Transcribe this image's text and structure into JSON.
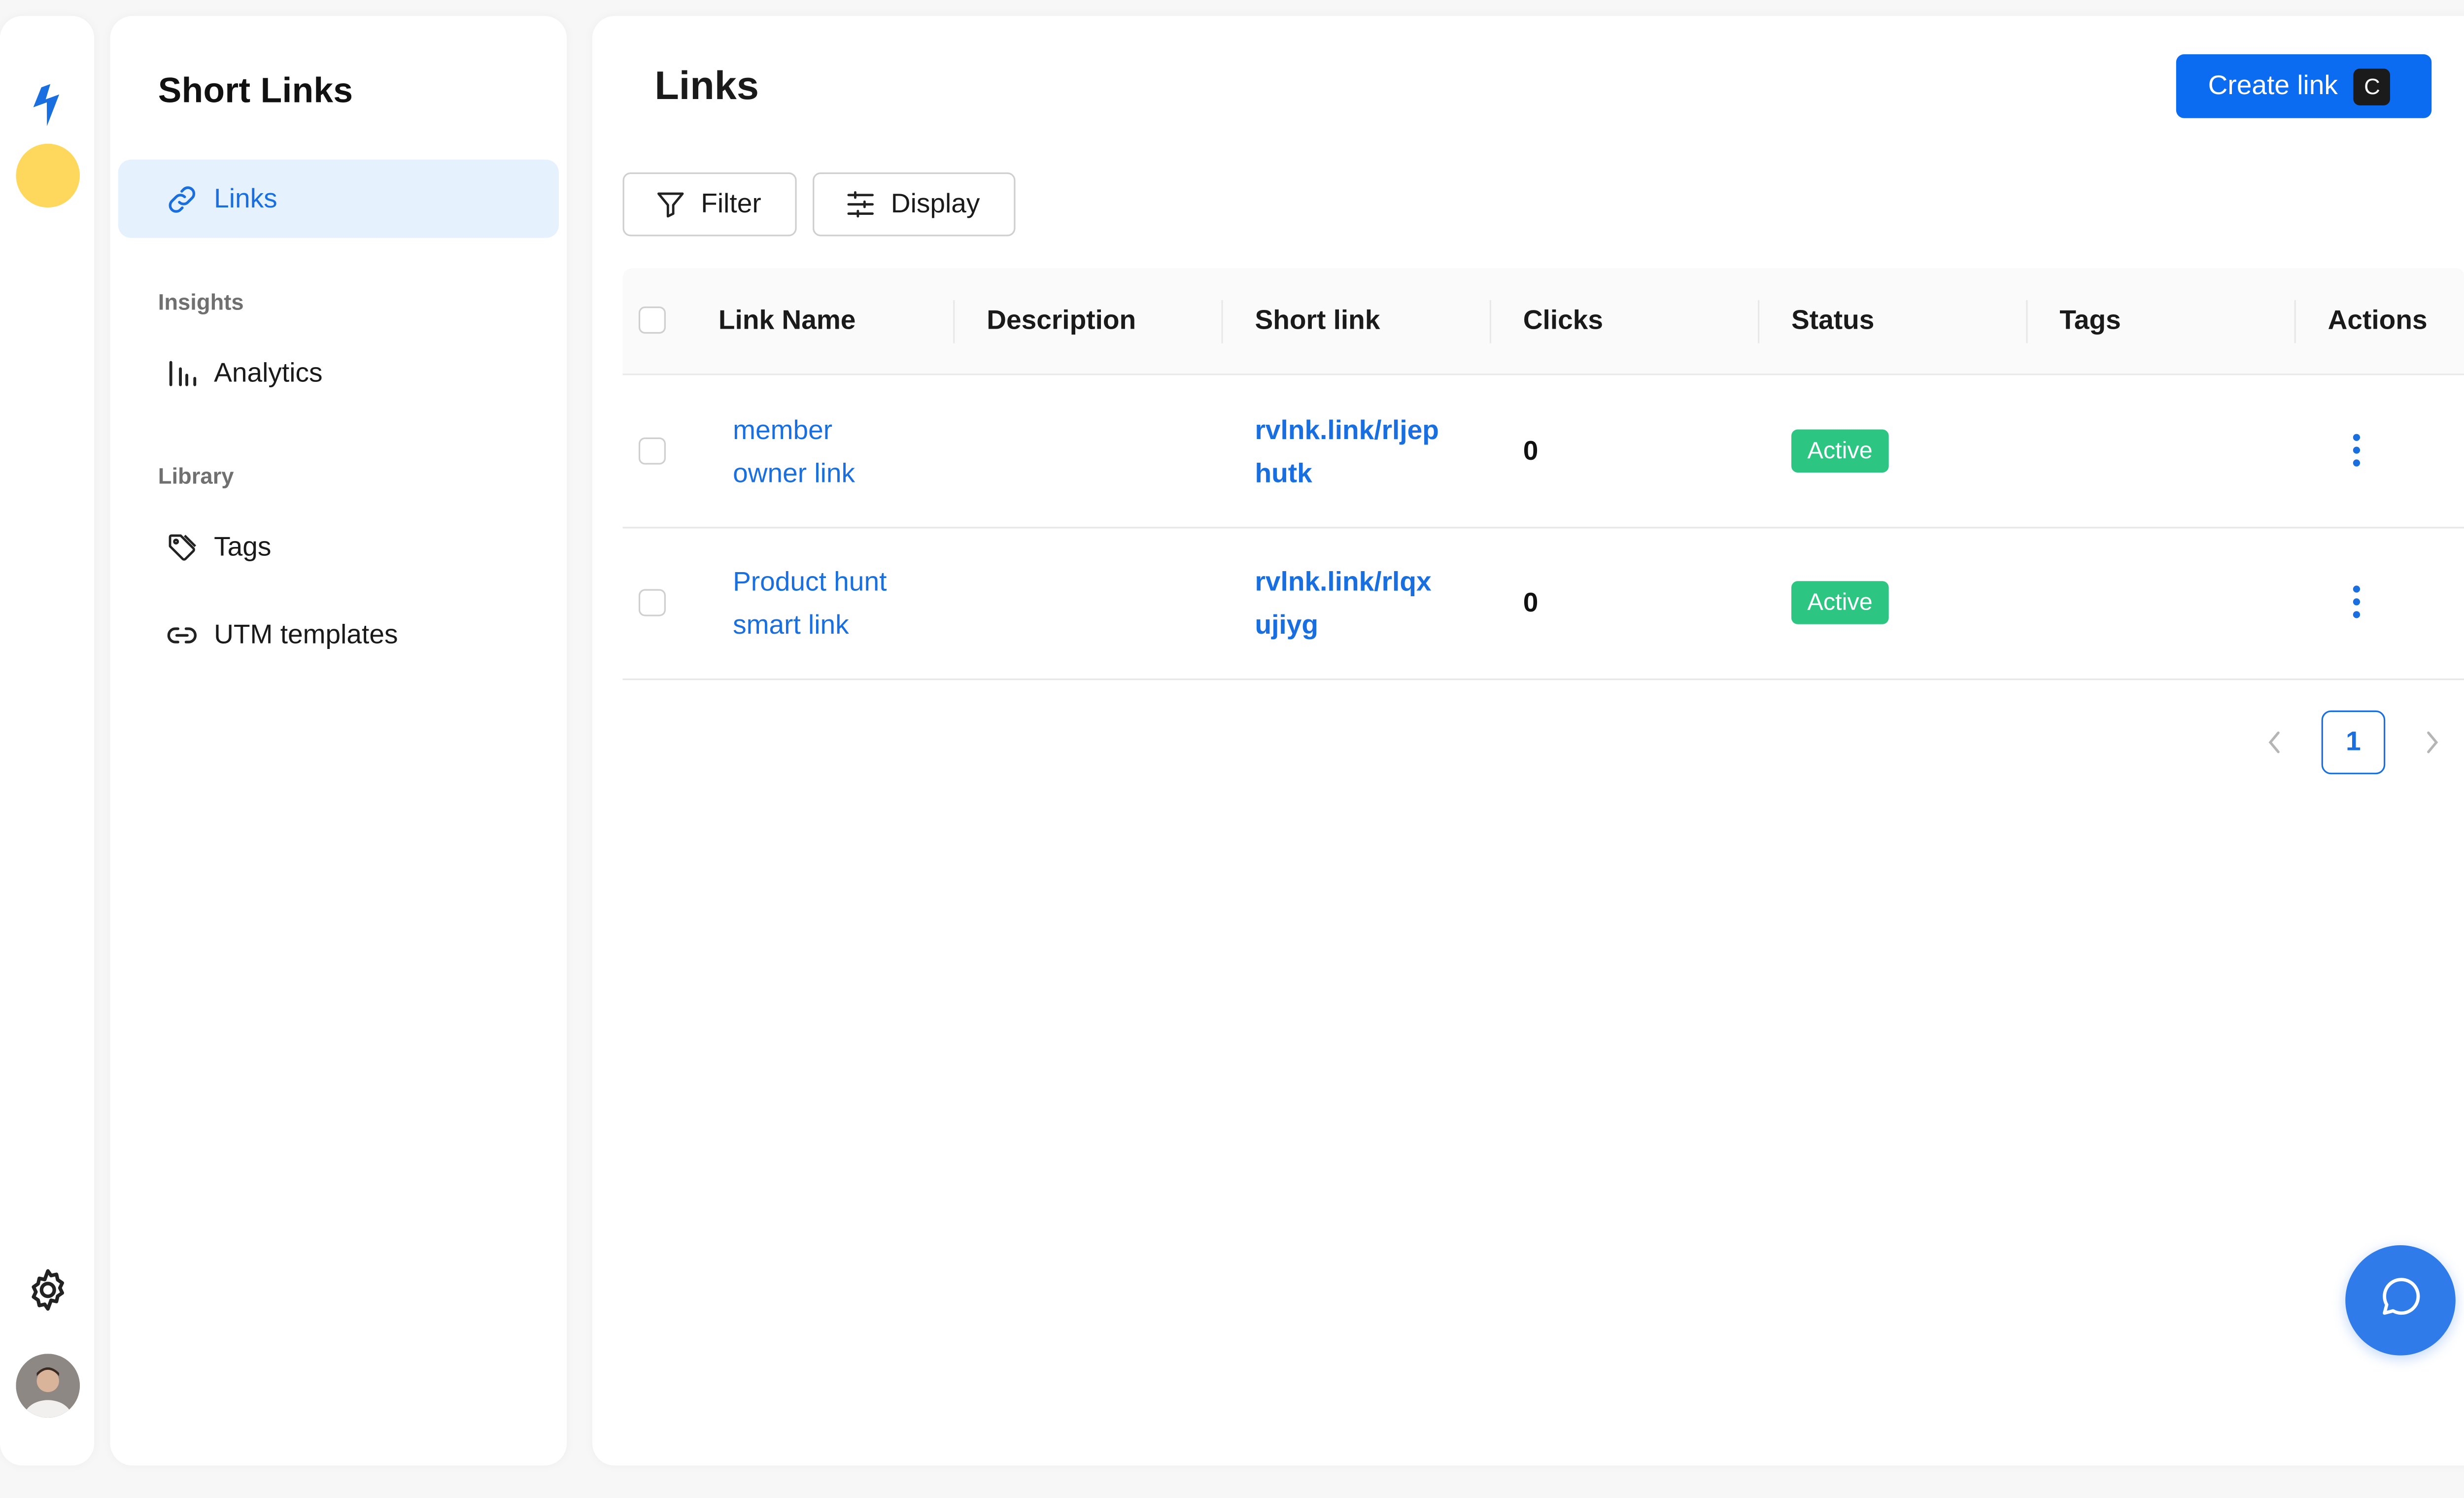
{
  "app": {
    "brand_icon": "short-links-logo",
    "workspace_color": "#fdd85c"
  },
  "sidebar": {
    "title": "Short Links",
    "links_label": "Links",
    "insights_heading": "Insights",
    "analytics_label": "Analytics",
    "library_heading": "Library",
    "tags_label": "Tags",
    "utm_label": "UTM templates"
  },
  "main": {
    "title": "Links",
    "create_button": "Create link",
    "create_shortcut": "C",
    "filter_label": "Filter",
    "display_label": "Display"
  },
  "table": {
    "columns": [
      "Link Name",
      "Description",
      "Short link",
      "Clicks",
      "Status",
      "Tags",
      "Actions"
    ],
    "rows": [
      {
        "name_line1": "member",
        "name_line2": "owner link",
        "description": "",
        "short_line1": "rvlnk.link/rljep",
        "short_line2": "hutk",
        "clicks": "0",
        "status": "Active",
        "tags": ""
      },
      {
        "name_line1": "Product hunt",
        "name_line2": "smart link",
        "description": "",
        "short_line1": "rvlnk.link/rlqx",
        "short_line2": "ujiyg",
        "clicks": "0",
        "status": "Active",
        "tags": ""
      }
    ]
  },
  "pagination": {
    "current_page": "1"
  },
  "colors": {
    "accent": "#1a6fe0",
    "primary_button": "#0c6cf1",
    "status_active": "#2cc582",
    "chat": "#2f7be9"
  }
}
